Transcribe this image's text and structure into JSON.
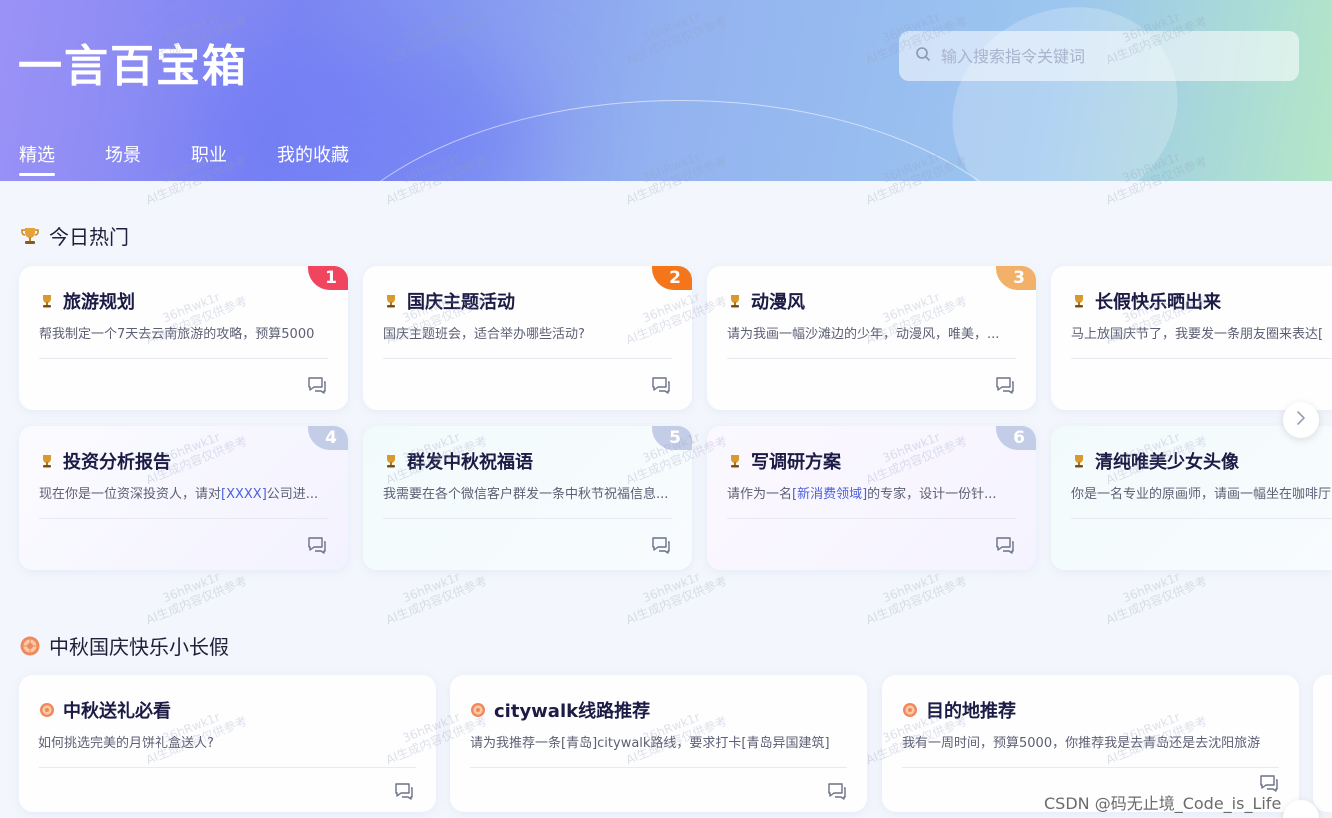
{
  "app": {
    "brand": "一言百宝箱",
    "search_placeholder": "输入搜索指令关键词",
    "tabs": [
      {
        "label": "精选",
        "active": true
      },
      {
        "label": "场景",
        "active": false
      },
      {
        "label": "职业",
        "active": false
      },
      {
        "label": "我的收藏",
        "active": false
      }
    ]
  },
  "hot": {
    "title": "今日热门",
    "cards": [
      {
        "rank": "1",
        "title": "旅游规划",
        "desc": "帮我制定一个7天去云南旅游的攻略，预算5000"
      },
      {
        "rank": "2",
        "title": "国庆主题活动",
        "desc": "国庆主题班会，适合举办哪些活动?"
      },
      {
        "rank": "3",
        "title": "动漫风",
        "desc": "请为我画一幅沙滩边的少年，动漫风，唯美，..."
      },
      {
        "rank": "",
        "title": "长假快乐晒出来",
        "desc": "马上放国庆节了，我要发一条朋友圈来表达["
      },
      {
        "rank": "4",
        "title": "投资分析报告",
        "desc_pre": "现在你是一位资深投资人，请对",
        "desc_hl": "[XXXX]",
        "desc_post": "公司进..."
      },
      {
        "rank": "5",
        "title": "群发中秋祝福语",
        "desc": "我需要在各个微信客户群发一条中秋节祝福信息..."
      },
      {
        "rank": "6",
        "title": "写调研方案",
        "desc_pre": "请作为一名",
        "desc_hl": "[新消费领域]",
        "desc_post": "的专家，设计一份针..."
      },
      {
        "rank": "",
        "title": "清纯唯美少女头像",
        "desc": "你是一名专业的原画师，请画一幅坐在咖啡厅"
      }
    ]
  },
  "holiday": {
    "title": "中秋国庆快乐小长假",
    "cards": [
      {
        "title": "中秋送礼必看",
        "desc": "如何挑选完美的月饼礼盒送人?"
      },
      {
        "title": "citywalk线路推荐",
        "desc": "请为我推荐一条[青岛]citywalk路线，要求打卡[青岛异国建筑]"
      },
      {
        "title": "目的地推荐",
        "desc": "我有一周时间，预算5000，你推荐我是去青岛还是去沈阳旅游"
      }
    ]
  },
  "watermark": {
    "line1": "36hRwk1r",
    "line2": "AI生成内容仅供参考"
  },
  "credit": "CSDN @码无止境_Code_is_Life",
  "colors": {
    "rank1": "#f0445f",
    "rank2": "#f5761a",
    "rank3": "#f2b068",
    "rank_other": "#c4cde8",
    "highlight": "#4b5fe0"
  },
  "icons": {
    "search": "search-icon",
    "trophy": "trophy-icon",
    "mooncake": "mooncake-icon",
    "chat": "chat-bubble-icon",
    "next": "chevron-right-icon"
  }
}
